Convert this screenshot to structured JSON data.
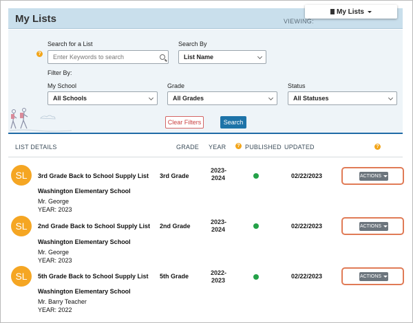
{
  "header": {
    "title": "My Lists",
    "viewing_label": "VIEWING:",
    "viewing_value": "My Lists"
  },
  "filters": {
    "search_label": "Search for a List",
    "search_placeholder": "Enter Keywords to search",
    "search_by_label": "Search By",
    "search_by_value": "List Name",
    "filter_by_label": "Filter By:",
    "school_label": "My School",
    "school_value": "All Schools",
    "grade_label": "Grade",
    "grade_value": "All Grades",
    "status_label": "Status",
    "status_value": "All Statuses",
    "clear_label": "Clear Filters",
    "search_button": "Search"
  },
  "columns": {
    "details": "LIST DETAILS",
    "grade": "GRADE",
    "year": "YEAR",
    "published": "PUBLISHED",
    "updated": "UPDATED"
  },
  "rows": [
    {
      "initials": "SL",
      "name": "3rd Grade Back to School Supply List",
      "school": "Washington Elementary School",
      "teacher": "Mr. George",
      "year_line": "YEAR: 2023",
      "grade": "3rd Grade",
      "year_top": "2023-",
      "year_bottom": "2024",
      "updated": "02/22/2023",
      "actions": "ACTIONS"
    },
    {
      "initials": "SL",
      "name": "2nd Grade Back to School Supply List",
      "school": "Washington Elementary School",
      "teacher": "Mr. George",
      "year_line": "YEAR: 2023",
      "grade": "2nd Grade",
      "year_top": "2023-",
      "year_bottom": "2024",
      "updated": "02/22/2023",
      "actions": "ACTIONS"
    },
    {
      "initials": "SL",
      "name": "5th Grade Back to School Supply List",
      "school": "Washington Elementary School",
      "teacher": "Mr. Barry Teacher",
      "year_line": "YEAR: 2022",
      "grade": "5th Grade",
      "year_top": "2022-",
      "year_bottom": "2023",
      "updated": "02/22/2023",
      "actions": "ACTIONS"
    }
  ],
  "colors": {
    "header_bg": "#c9dfec",
    "accent_blue": "#1d73a8",
    "avatar": "#f5a623",
    "published": "#24a148",
    "highlight": "#e07a55"
  }
}
